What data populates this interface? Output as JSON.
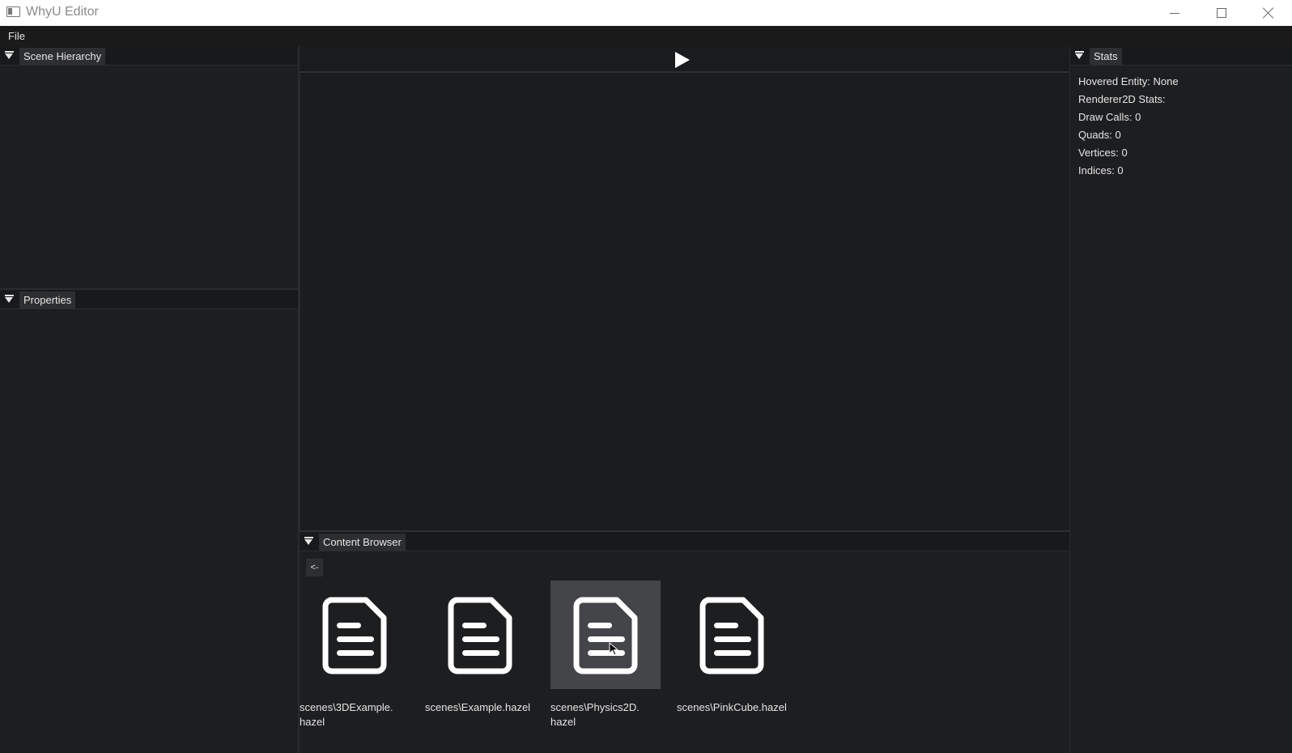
{
  "window": {
    "title": "WhyU Editor",
    "app_icon": "window-app-icon",
    "minimize_icon": "minimize-icon",
    "maximize_icon": "maximize-icon",
    "close_icon": "close-icon"
  },
  "menubar": {
    "items": [
      {
        "label": "File"
      }
    ]
  },
  "panels": {
    "scene_hierarchy": {
      "title": "Scene Hierarchy"
    },
    "properties": {
      "title": "Properties"
    },
    "stats": {
      "title": "Stats",
      "lines": [
        "Hovered Entity: None",
        "Renderer2D Stats:",
        "Draw Calls: 0",
        "Quads: 0",
        "Vertices: 0",
        "Indices: 0"
      ]
    },
    "content_browser": {
      "title": "Content Browser",
      "back_label": "<-",
      "files": [
        {
          "label": "scenes\\3DExample.\nhazel",
          "selected": false
        },
        {
          "label": "scenes\\Example.hazel",
          "selected": false
        },
        {
          "label": "scenes\\Physics2D.\nhazel",
          "selected": true
        },
        {
          "label": "scenes\\PinkCube.hazel",
          "selected": false
        }
      ]
    }
  },
  "viewport": {
    "play_icon": "play-icon"
  },
  "colors": {
    "background": "#1a1b1d",
    "panel_tab": "#2d2e30",
    "selected_tile": "#444548",
    "text": "#e6e6e6"
  }
}
